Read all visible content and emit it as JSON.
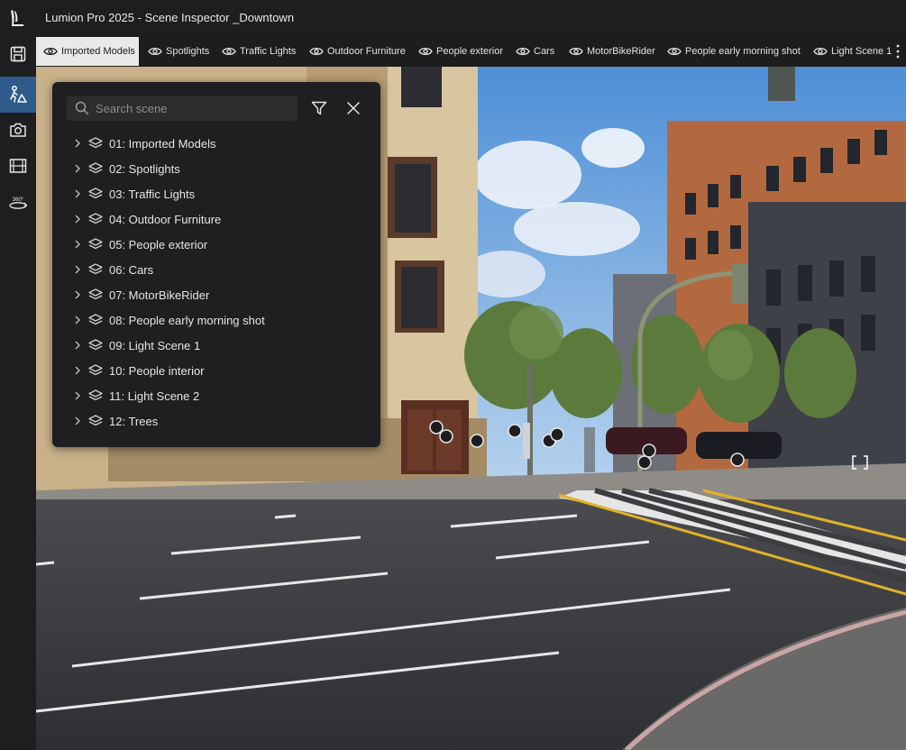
{
  "window": {
    "title": "Lumion Pro 2025 - Scene Inspector _Downtown"
  },
  "rail": {
    "items": [
      {
        "name": "save",
        "icon": "save-icon"
      },
      {
        "name": "build",
        "icon": "build-mode-icon",
        "active": true
      },
      {
        "name": "photo",
        "icon": "camera-icon"
      },
      {
        "name": "movie",
        "icon": "film-icon"
      },
      {
        "name": "panorama",
        "icon": "panorama-360-icon",
        "label": "360°"
      }
    ]
  },
  "tabs": [
    {
      "label": "Imported Models",
      "selected": true
    },
    {
      "label": "Spotlights"
    },
    {
      "label": "Traffic Lights"
    },
    {
      "label": "Outdoor Furniture"
    },
    {
      "label": "People exterior"
    },
    {
      "label": "Cars"
    },
    {
      "label": "MotorBikeRider"
    },
    {
      "label": "People early morning shot"
    },
    {
      "label": "Light Scene 1"
    }
  ],
  "scene_panel": {
    "search": {
      "placeholder": "Search scene",
      "value": ""
    },
    "filter_icon": "filter-icon",
    "close_icon": "close-icon",
    "items": [
      {
        "label": "01: Imported Models"
      },
      {
        "label": "02: Spotlights"
      },
      {
        "label": "03: Traffic Lights"
      },
      {
        "label": "04: Outdoor Furniture"
      },
      {
        "label": "05: People exterior"
      },
      {
        "label": "06: Cars"
      },
      {
        "label": "07: MotorBikeRider"
      },
      {
        "label": "08: People early morning shot"
      },
      {
        "label": "09: Light Scene 1"
      },
      {
        "label": "10: People interior"
      },
      {
        "label": "11: Light Scene 2"
      },
      {
        "label": "12: Trees"
      }
    ]
  },
  "colors": {
    "accent": "#2f5a8c",
    "panel": "#1f1f21",
    "tab_selected": "#e9e9e9"
  }
}
